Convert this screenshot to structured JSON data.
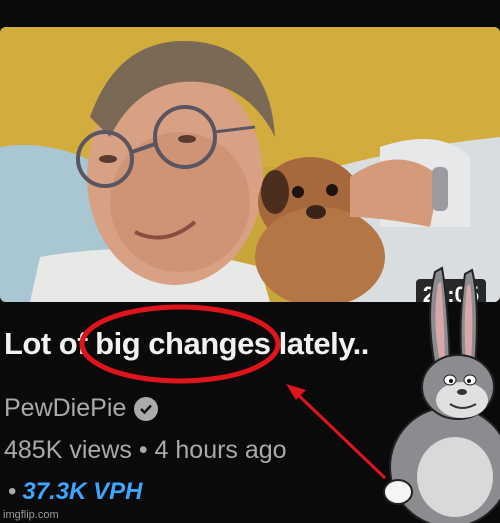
{
  "video": {
    "duration": "22:05",
    "title": "Lot of big changes lately..",
    "channel": "PewDiePie",
    "views": "485K views",
    "separator": "•",
    "age": "4 hours ago",
    "vph_dot": "•",
    "vph": "37.3K VPH"
  },
  "icons": {
    "verified": "verified-check-icon"
  },
  "annotation": {
    "circle_color": "#e0141b",
    "arrow_color": "#e0141b"
  },
  "watermark": "imgflip.com"
}
